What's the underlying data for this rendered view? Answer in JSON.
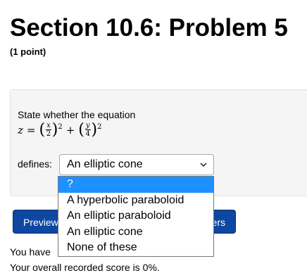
{
  "title": "Section 10.6: Problem 5",
  "points": "(1 point)",
  "prompt": "State whether the equation",
  "equation": {
    "lhs": "z",
    "eq": "=",
    "frac1_num": "x",
    "frac1_den": "2",
    "frac2_num": "y",
    "frac2_den": "4",
    "exp": "2",
    "plus": "+"
  },
  "defines_label": "defines:",
  "select": {
    "value": "An elliptic cone",
    "options": [
      "?",
      "A hyperbolic paraboloid",
      "An elliptic paraboloid",
      "An elliptic cone",
      "None of these"
    ]
  },
  "buttons": {
    "preview": "Preview",
    "answers_tail": "ers"
  },
  "info": {
    "line1": "You have",
    "line2": "Your overall recorded score is 0%."
  },
  "icons": {
    "select_arrow": "chevron-down-icon"
  }
}
